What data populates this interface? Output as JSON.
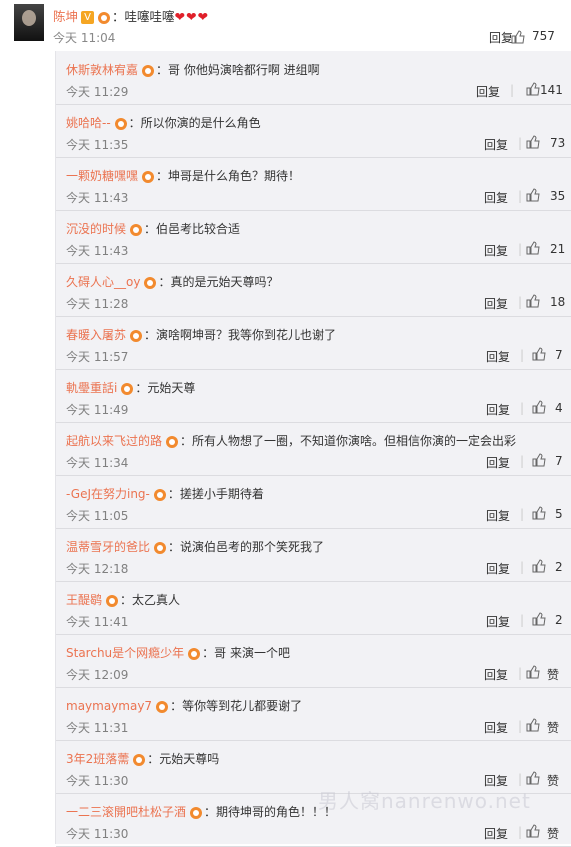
{
  "top": {
    "username": "陈坤",
    "text": "：哇噻哇噻",
    "hearts": "❤❤❤",
    "time": "今天 11:04",
    "reply": "回复",
    "likes": "757"
  },
  "replies": [
    {
      "user": "休斯敦林宥嘉",
      "text": "：哥 你他妈演啥都行啊 进组啊",
      "time": "今天 11:29",
      "reply": "回复",
      "likes": "141"
    },
    {
      "user": "姚哈哈--",
      "text": "：所以你演的是什么角色",
      "time": "今天 11:35",
      "reply": "回复",
      "likes": "73"
    },
    {
      "user": "一颗奶糖嘿嘿",
      "text": "：坤哥是什么角色？期待！",
      "time": "今天 11:43",
      "reply": "回复",
      "likes": "35"
    },
    {
      "user": "沉没的时候",
      "text": "：伯邑考比较合适",
      "time": "今天 11:43",
      "reply": "回复",
      "likes": "21"
    },
    {
      "user": "久碍人心__oy",
      "text": "：真的是元始天尊吗？",
      "time": "今天 11:28",
      "reply": "回复",
      "likes": "18"
    },
    {
      "user": "春暖入屠苏",
      "text": "：演啥啊坤哥？我等你到花儿也谢了",
      "time": "今天 11:57",
      "reply": "回复",
      "likes": "7"
    },
    {
      "user": "軌璺重話i",
      "text": "：元始天尊",
      "time": "今天 11:49",
      "reply": "回复",
      "likes": "4"
    },
    {
      "user": "起航以来飞过的路",
      "text": "：所有人物想了一圈，不知道你演啥。但相信你演的一定会出彩",
      "time": "今天 11:34",
      "reply": "回复",
      "likes": "7"
    },
    {
      "user": "-GeJ在努力ing-",
      "text": "：搓搓小手期待着",
      "time": "今天 11:05",
      "reply": "回复",
      "likes": "5"
    },
    {
      "user": "温蒂雪牙的爸比",
      "text": "：说演伯邑考的那个笑死我了",
      "time": "今天 12:18",
      "reply": "回复",
      "likes": "2"
    },
    {
      "user": "王醍鹖",
      "text": "：太乙真人",
      "time": "今天 11:41",
      "reply": "回复",
      "likes": "2"
    },
    {
      "user": "Starchu是个网瘾少年",
      "text": "：哥 来演一个吧",
      "time": "今天 12:09",
      "reply": "回复",
      "likes": "赞"
    },
    {
      "user": "maymaymay7",
      "text": "：等你等到花儿都要谢了",
      "time": "今天 11:31",
      "reply": "回复",
      "likes": "赞"
    },
    {
      "user": "3年2班落薷",
      "text": "：元始天尊吗",
      "time": "今天 11:30",
      "reply": "回复",
      "likes": "赞"
    },
    {
      "user": "一二三滚開吧杜松子酒",
      "text": "：期待坤哥的角色！！！",
      "time": "今天 11:30",
      "reply": "回复",
      "likes": "赞"
    }
  ],
  "watermark": "男人窝nanrenwo.net"
}
